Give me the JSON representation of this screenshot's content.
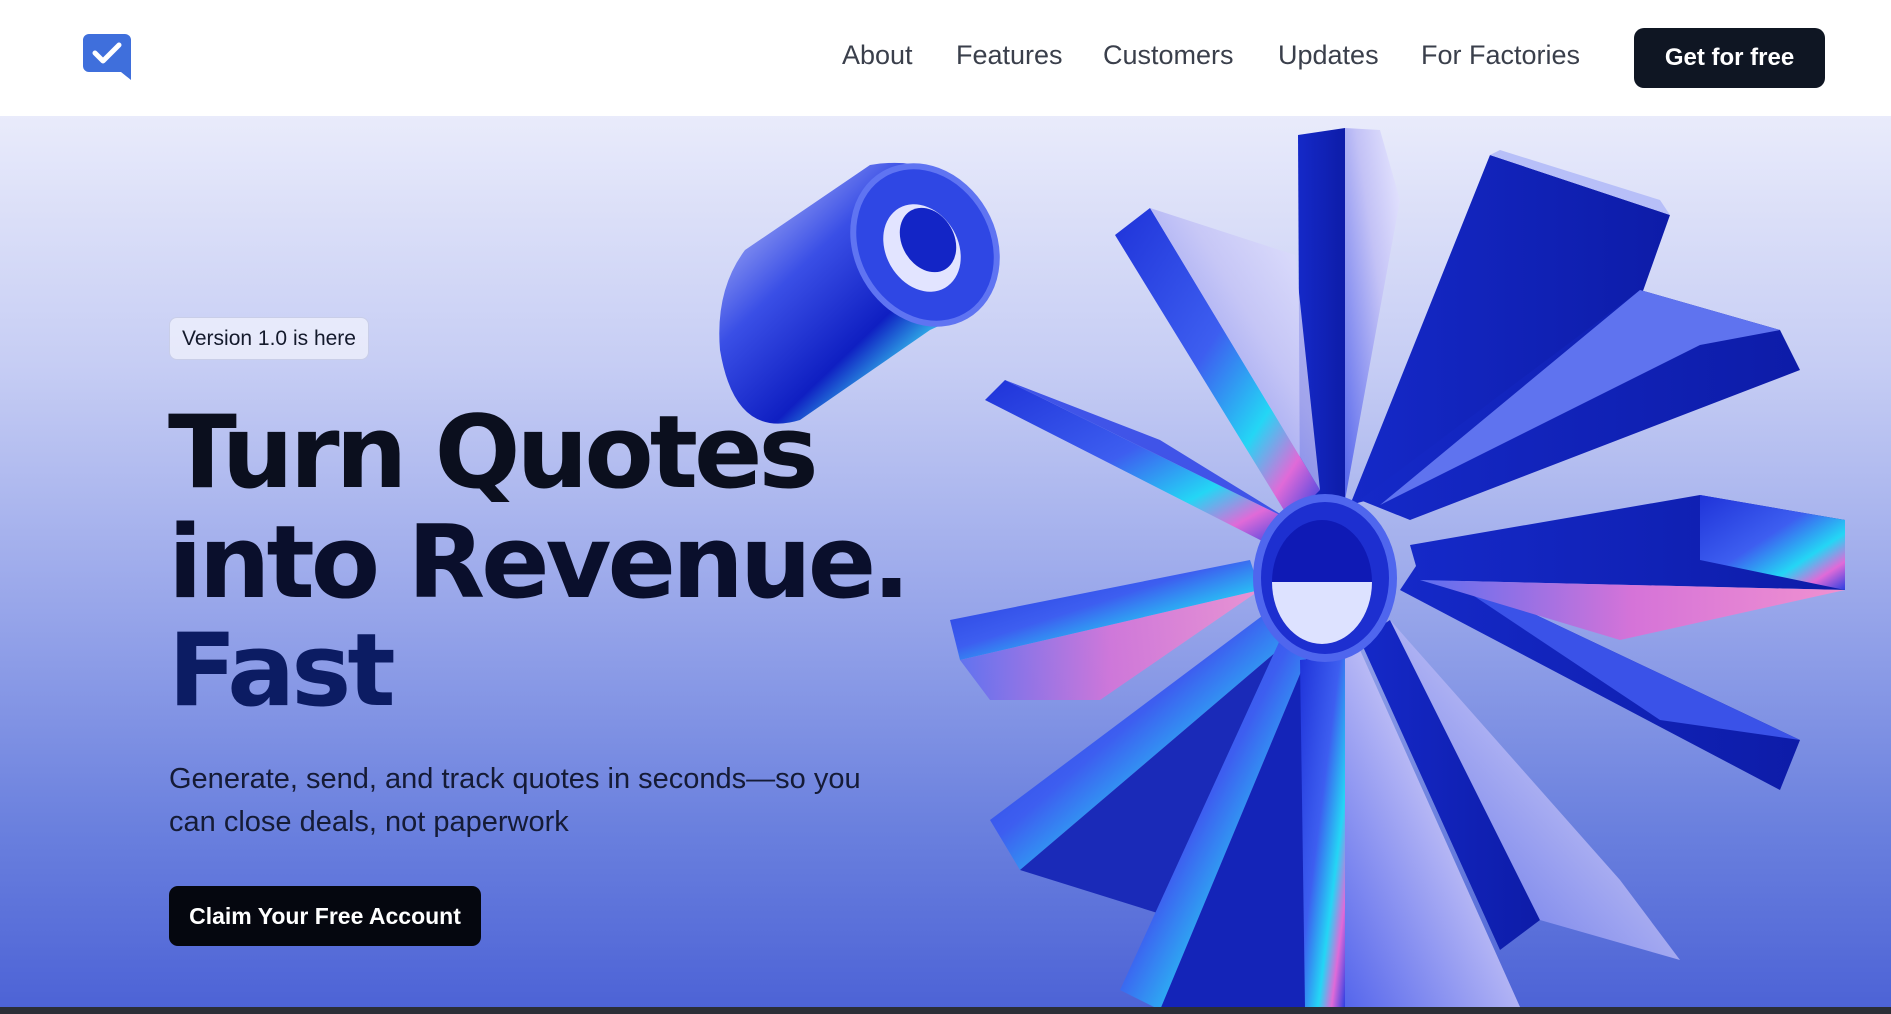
{
  "header": {
    "logo_icon": "checkmark-chat-icon",
    "nav": {
      "about": "About",
      "features": "Features",
      "customers": "Customers",
      "updates": "Updates",
      "factories": "For Factories"
    },
    "cta_label": "Get for free"
  },
  "hero": {
    "badge": "Version 1.0 is here",
    "headline_line1": "Turn Quotes",
    "headline_line2": "into Revenue.",
    "headline_line3": "Fast",
    "subtext": "Generate, send, and track quotes in seconds—so you can close deals, not paperwork",
    "cta_label": "Claim Your Free Account"
  },
  "colors": {
    "brand_blue": "#3f6fdc",
    "dark_button": "#0f1623",
    "hero_top": "#e9ebfb",
    "hero_bottom": "#4d63d6",
    "headline_fast": "#0c1c63"
  }
}
